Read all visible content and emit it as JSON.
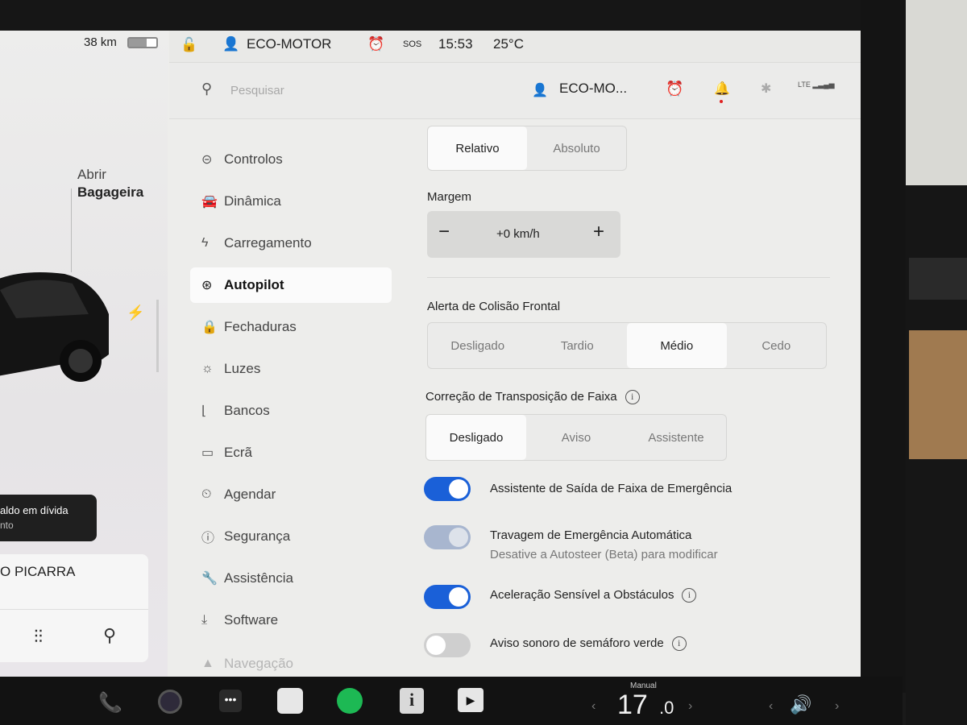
{
  "car_panel": {
    "range": "38 km",
    "battery_level": 0.65,
    "trunk_line1": "Abrir",
    "trunk_line2": "Bagageira",
    "toast_title": "aldo em dívida",
    "toast_sub": "nto",
    "media_title": "O PICARRA",
    "eq_icon": "equalizer-icon",
    "search_icon": "search-icon"
  },
  "status_bar": {
    "profile": "ECO-MOTOR",
    "sos": "SOS",
    "time": "15:53",
    "temperature": "25°C"
  },
  "header": {
    "search_placeholder": "Pesquisar",
    "profile": "ECO-MO...",
    "lte": "LTE"
  },
  "nav": {
    "items": [
      {
        "label": "Controlos",
        "icon": "toggle-icon"
      },
      {
        "label": "Dinâmica",
        "icon": "car-icon"
      },
      {
        "label": "Carregamento",
        "icon": "bolt-icon"
      },
      {
        "label": "Autopilot",
        "icon": "steering-wheel-icon"
      },
      {
        "label": "Fechaduras",
        "icon": "lock-icon"
      },
      {
        "label": "Luzes",
        "icon": "light-icon"
      },
      {
        "label": "Bancos",
        "icon": "seat-icon"
      },
      {
        "label": "Ecrã",
        "icon": "display-icon"
      },
      {
        "label": "Agendar",
        "icon": "schedule-icon"
      },
      {
        "label": "Segurança",
        "icon": "safety-icon"
      },
      {
        "label": "Assistência",
        "icon": "wrench-icon"
      },
      {
        "label": "Software",
        "icon": "download-icon"
      },
      {
        "label": "Navegação",
        "icon": "navigation-icon"
      }
    ],
    "active": "Autopilot"
  },
  "content": {
    "speed_mode": {
      "options": [
        "Relativo",
        "Absoluto"
      ],
      "selected": "Relativo"
    },
    "margin_label": "Margem",
    "margin_minus": "−",
    "margin_value": "+0 km/h",
    "margin_plus": "+",
    "collision": {
      "label": "Alerta de Colisão Frontal",
      "options": [
        "Desligado",
        "Tardio",
        "Médio",
        "Cedo"
      ],
      "selected": "Médio"
    },
    "lane": {
      "label": "Correção de Transposição de Faixa",
      "options": [
        "Desligado",
        "Aviso",
        "Assistente"
      ],
      "selected": "Desligado"
    },
    "toggles": [
      {
        "label": "Assistente de Saída de Faixa de Emergência",
        "state": "on"
      },
      {
        "label": "Travagem de Emergência Automática",
        "sub": "Desative a Autosteer (Beta) para modificar",
        "state": "on-disabled"
      },
      {
        "label": "Aceleração Sensível a Obstáculos",
        "state": "on",
        "info": true
      },
      {
        "label": "Aviso sonoro de semáforo verde",
        "state": "off",
        "info": true
      }
    ]
  },
  "taskbar": {
    "temp_label": "Manual",
    "temp_value": "17",
    "temp_decimal": ".0"
  }
}
